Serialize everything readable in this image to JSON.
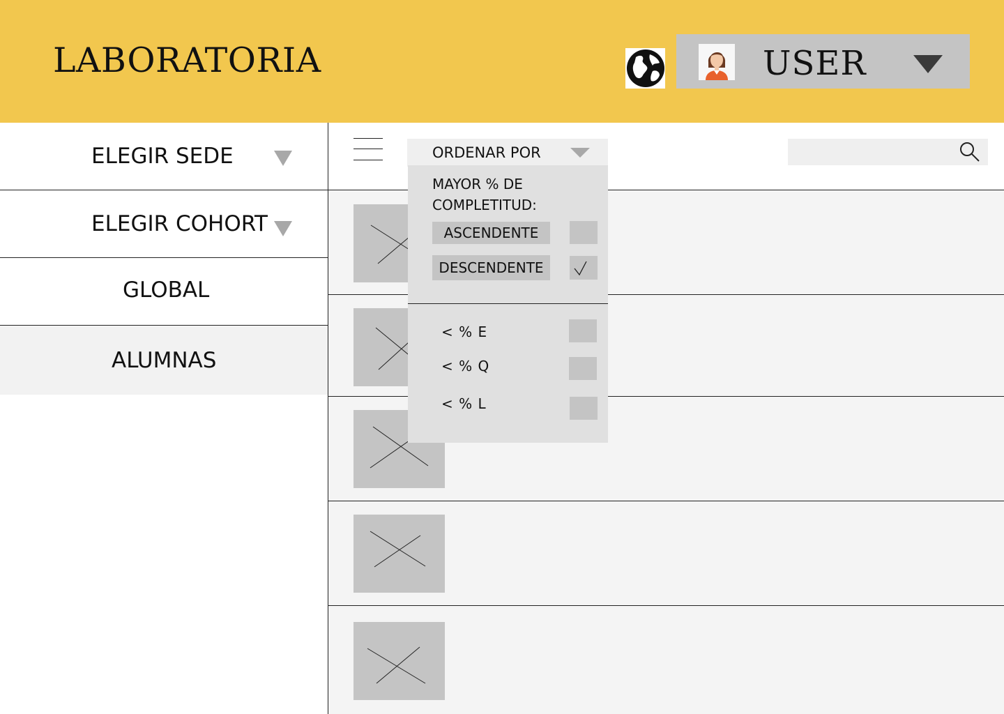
{
  "header": {
    "brand": "LABORATORIA",
    "user_label": "USER",
    "background": "#f2c74e"
  },
  "icons": {
    "globe": "globe-icon",
    "avatar": "user-avatar",
    "user_menu": "caret-down-icon",
    "menu": "hamburger-icon",
    "search": "search-icon"
  },
  "sidebar": {
    "items": [
      {
        "label": "ELEGIR SEDE",
        "has_dropdown": true
      },
      {
        "label": "ELEGIR COHORT",
        "has_dropdown": true
      },
      {
        "label": "GLOBAL",
        "has_dropdown": false
      },
      {
        "label": "ALUMNAS",
        "has_dropdown": false,
        "active": true
      }
    ]
  },
  "toolbar": {
    "sort_label": "ORDENAR POR",
    "search_value": ""
  },
  "sort_menu": {
    "title": "MAYOR % DE COMPLETITUD:",
    "options": [
      {
        "label": "ASCENDENTE",
        "checked": false
      },
      {
        "label": "DESCENDENTE",
        "checked": true
      }
    ],
    "filters": [
      {
        "label": "< % E",
        "checked": false
      },
      {
        "label": "< % Q",
        "checked": false
      },
      {
        "label": "< % L",
        "checked": false
      }
    ]
  },
  "list": {
    "row_count": 5
  }
}
